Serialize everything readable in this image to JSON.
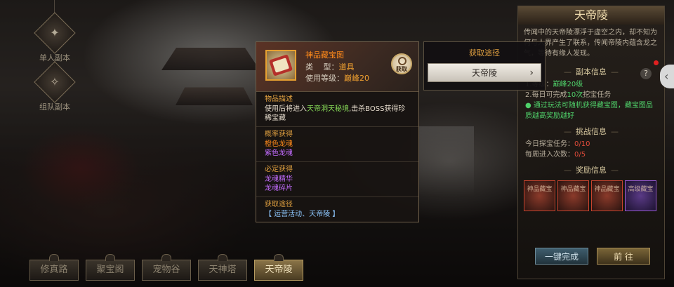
{
  "sidebar": {
    "items": [
      {
        "label": "单人副本"
      },
      {
        "label": "组队副本"
      }
    ]
  },
  "bottom_tabs": [
    {
      "label": "修真路"
    },
    {
      "label": "聚宝阁"
    },
    {
      "label": "宠物谷"
    },
    {
      "label": "天神塔"
    },
    {
      "label": "天帝陵",
      "active": true
    }
  ],
  "right_panel": {
    "title": "天帝陵",
    "intro": "传闻中的天帝陵漂浮于虚空之内，却不知为何与人界产生了联系，传闻帝陵内蕴含龙之气，等待有缘人发现。",
    "section_dungeon": "副本信息",
    "dungeon_lines": [
      {
        "prefix": "1.等级：",
        "value": "巅峰20级"
      },
      {
        "prefix": "2.每日可完成",
        "value": "10次",
        "suffix": "挖宝任务"
      }
    ],
    "dungeon_note": "● 通过玩法可随机获得藏宝图，藏宝图品质越高奖励越好",
    "section_challenge": "挑战信息",
    "challenge_lines": [
      {
        "label": "今日探宝任务：",
        "value": "0/10"
      },
      {
        "label": "每周进入次数：",
        "value": "0/5"
      }
    ],
    "section_reward": "奖励信息",
    "rewards": [
      {
        "label": "神品藏宝"
      },
      {
        "label": "神品藏宝"
      },
      {
        "label": "神品藏宝"
      },
      {
        "label": "高级藏宝"
      }
    ],
    "btn_onekey": "一键完成",
    "btn_go": "前 往"
  },
  "tooltip": {
    "item_name": "神品藏宝图",
    "type_label": "类　 型：",
    "type_value": "道具",
    "level_label": "使用等级：",
    "level_value": "巅峰20",
    "obtain_icon_label": "获取",
    "desc_title": "物品描述",
    "desc_pre": "使用后将进入",
    "desc_highlight": "天帝洞天秘境",
    "desc_post": ",击杀BOSS获得珍稀宝藏",
    "chance_title": "概率获得",
    "chance_items": [
      "橙色龙魂",
      "紫色龙魂"
    ],
    "sure_title": "必定获得",
    "sure_items": [
      "龙魂精华",
      "龙魂碎片"
    ],
    "route_title": "获取途径",
    "route_text": "【 运营活动、天帝陵 】"
  },
  "route_panel": {
    "title": "获取途径",
    "button": "天帝陵"
  },
  "colors": {
    "orange": "#ff8a1a",
    "purple": "#c36cff",
    "green": "#4fd16a",
    "red": "#e04b3a",
    "gold": "#e0a040"
  },
  "icons": [
    "magnifier-icon",
    "chevron-right-icon",
    "help-icon",
    "collapse-chevron-icon",
    "treasure-map-icon"
  ]
}
